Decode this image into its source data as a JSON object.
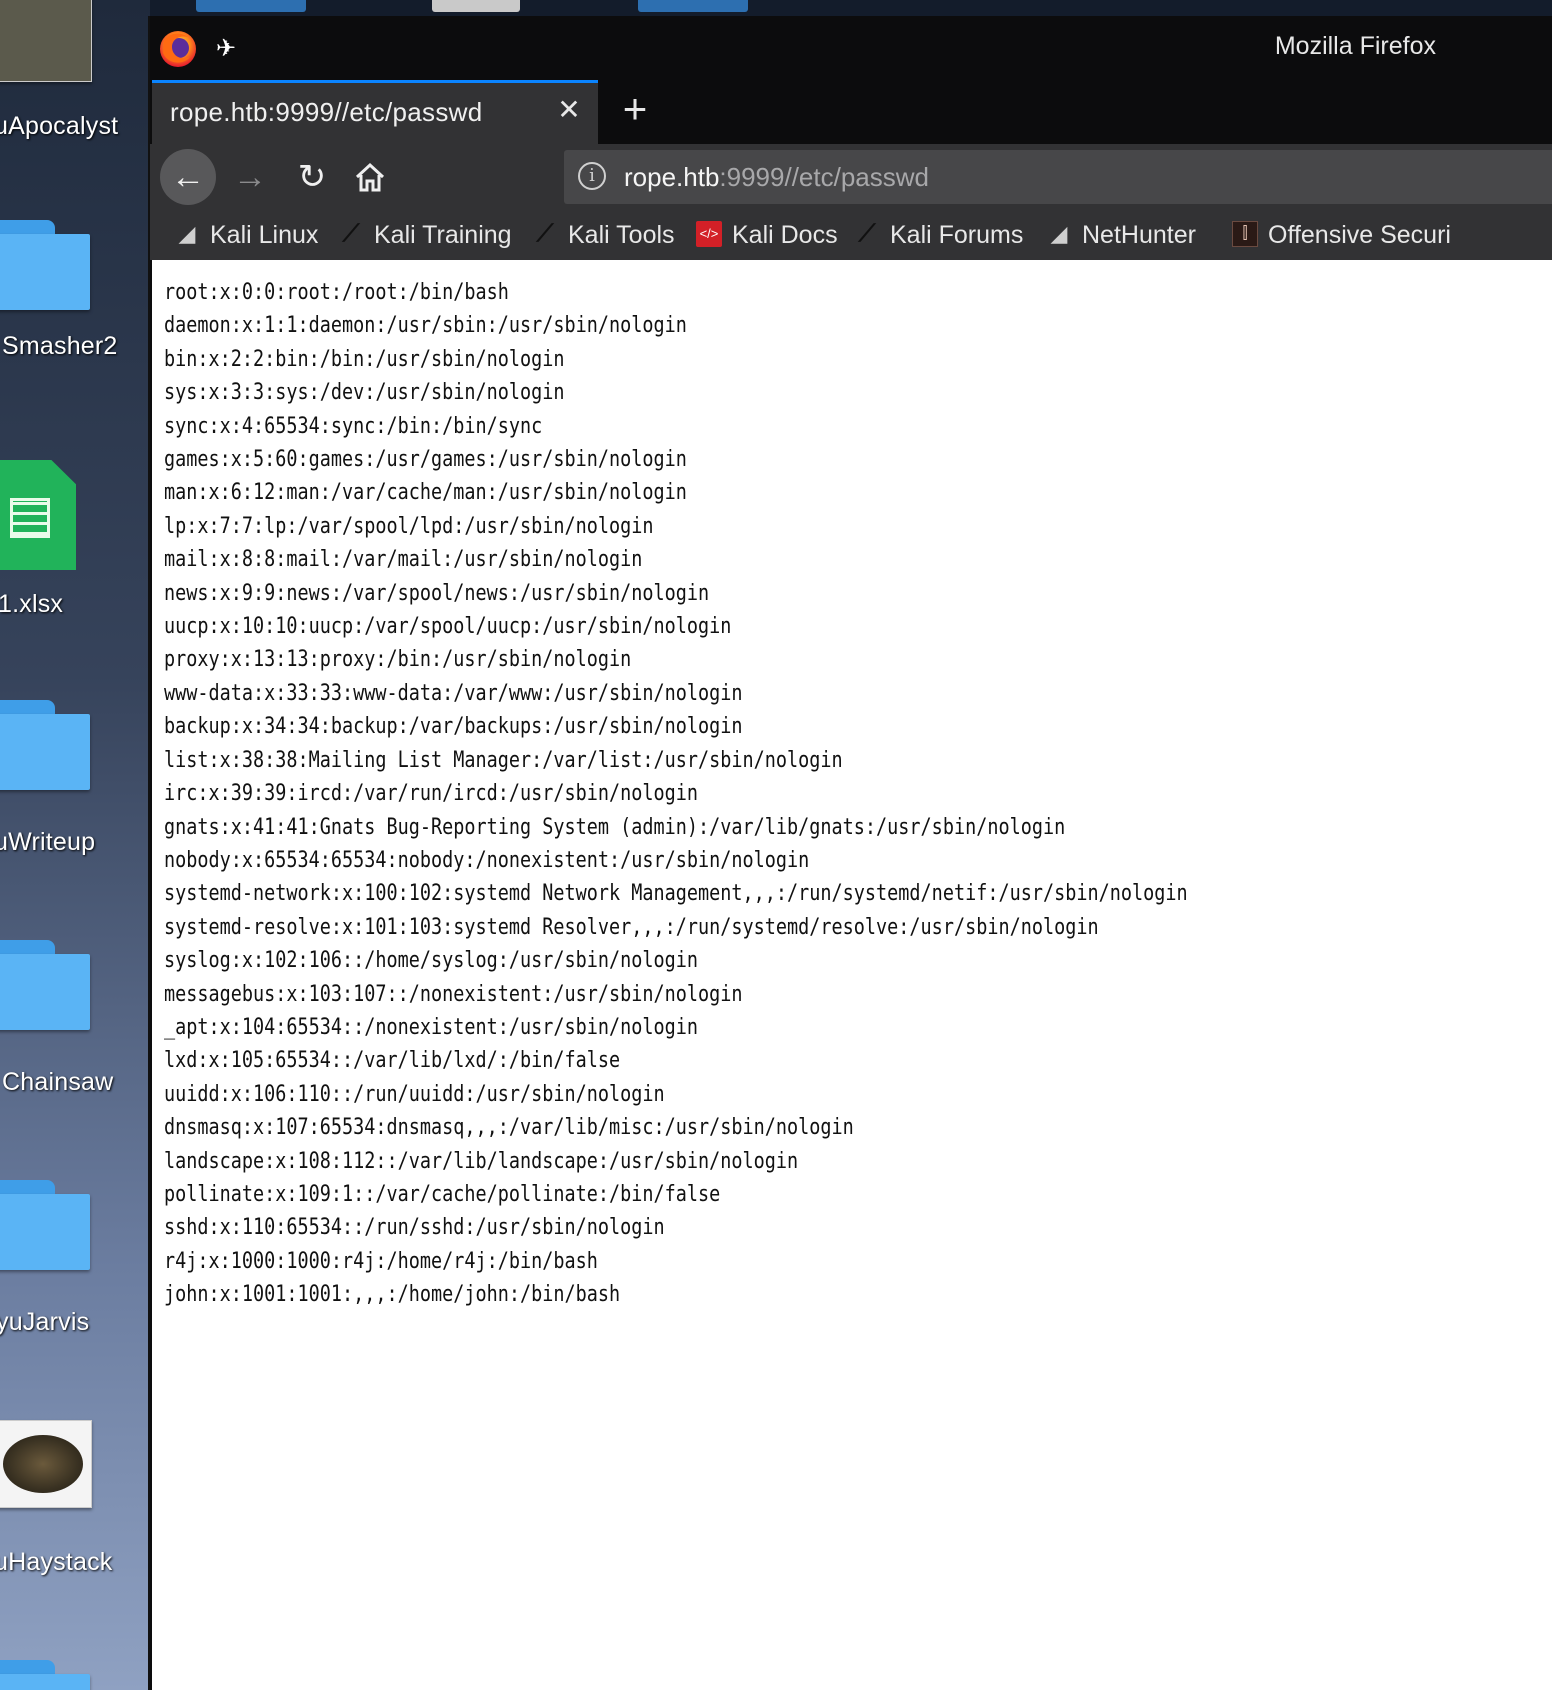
{
  "desktop": {
    "icons": [
      {
        "label": "uApocalyst",
        "kind": "thumbnail"
      },
      {
        "label": "Smasher2",
        "kind": "folder"
      },
      {
        "label": "1.xlsx",
        "kind": "spreadsheet"
      },
      {
        "label": "uWriteup",
        "kind": "folder"
      },
      {
        "label": "Chainsaw",
        "kind": "folder"
      },
      {
        "label": "yuJarvis",
        "kind": "folder"
      },
      {
        "label": "uHaystack",
        "kind": "thumbnail"
      }
    ]
  },
  "window": {
    "title": "Mozilla Firefox",
    "tab": {
      "title": "rope.htb:9999//etc/passwd"
    },
    "urlbar": {
      "host": "rope.htb",
      "rest": ":9999//etc/passwd"
    },
    "bookmarks": [
      {
        "label": "Kali Linux",
        "icon": "kali-dragon-icon"
      },
      {
        "label": "Kali Training",
        "icon": "kali-knife-icon"
      },
      {
        "label": "Kali Tools",
        "icon": "kali-knife-icon"
      },
      {
        "label": "Kali Docs",
        "icon": "kali-docs-icon"
      },
      {
        "label": "Kali Forums",
        "icon": "kali-knife-icon"
      },
      {
        "label": "NetHunter",
        "icon": "kali-dragon-icon"
      },
      {
        "label": "Offensive Securi",
        "icon": "offsec-icon"
      }
    ]
  },
  "page": {
    "lines": [
      "root:x:0:0:root:/root:/bin/bash",
      "daemon:x:1:1:daemon:/usr/sbin:/usr/sbin/nologin",
      "bin:x:2:2:bin:/bin:/usr/sbin/nologin",
      "sys:x:3:3:sys:/dev:/usr/sbin/nologin",
      "sync:x:4:65534:sync:/bin:/bin/sync",
      "games:x:5:60:games:/usr/games:/usr/sbin/nologin",
      "man:x:6:12:man:/var/cache/man:/usr/sbin/nologin",
      "lp:x:7:7:lp:/var/spool/lpd:/usr/sbin/nologin",
      "mail:x:8:8:mail:/var/mail:/usr/sbin/nologin",
      "news:x:9:9:news:/var/spool/news:/usr/sbin/nologin",
      "uucp:x:10:10:uucp:/var/spool/uucp:/usr/sbin/nologin",
      "proxy:x:13:13:proxy:/bin:/usr/sbin/nologin",
      "www-data:x:33:33:www-data:/var/www:/usr/sbin/nologin",
      "backup:x:34:34:backup:/var/backups:/usr/sbin/nologin",
      "list:x:38:38:Mailing List Manager:/var/list:/usr/sbin/nologin",
      "irc:x:39:39:ircd:/var/run/ircd:/usr/sbin/nologin",
      "gnats:x:41:41:Gnats Bug-Reporting System (admin):/var/lib/gnats:/usr/sbin/nologin",
      "nobody:x:65534:65534:nobody:/nonexistent:/usr/sbin/nologin",
      "systemd-network:x:100:102:systemd Network Management,,,:/run/systemd/netif:/usr/sbin/nologin",
      "systemd-resolve:x:101:103:systemd Resolver,,,:/run/systemd/resolve:/usr/sbin/nologin",
      "syslog:x:102:106::/home/syslog:/usr/sbin/nologin",
      "messagebus:x:103:107::/nonexistent:/usr/sbin/nologin",
      "_apt:x:104:65534::/nonexistent:/usr/sbin/nologin",
      "lxd:x:105:65534::/var/lib/lxd/:/bin/false",
      "uuidd:x:106:110::/run/uuidd:/usr/sbin/nologin",
      "dnsmasq:x:107:65534:dnsmasq,,,:/var/lib/misc:/usr/sbin/nologin",
      "landscape:x:108:112::/var/lib/landscape:/usr/sbin/nologin",
      "pollinate:x:109:1::/var/cache/pollinate:/bin/false",
      "sshd:x:110:65534::/run/sshd:/usr/sbin/nologin",
      "r4j:x:1000:1000:r4j:/home/r4j:/bin/bash",
      "john:x:1001:1001:,,,:/home/john:/bin/bash"
    ]
  }
}
